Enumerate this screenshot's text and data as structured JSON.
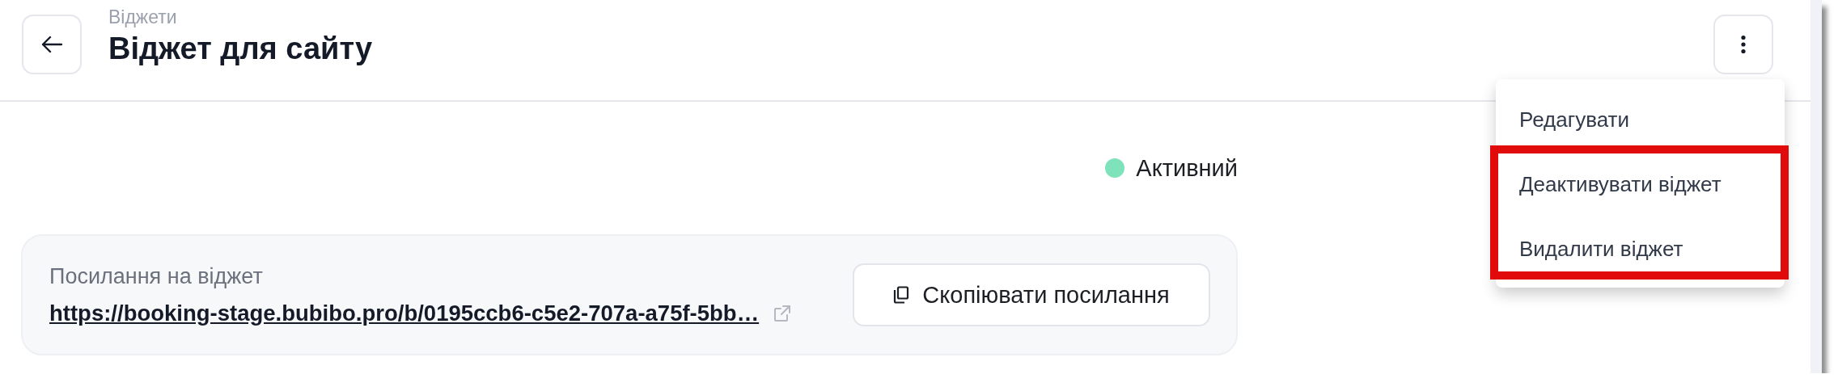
{
  "header": {
    "breadcrumb": "Віджети",
    "title": "Віджет для сайту"
  },
  "status": {
    "label": "Активний",
    "color": "#7ee2bb"
  },
  "link_card": {
    "label": "Посилання на віджет",
    "url": "https://booking-stage.bubibo.pro/b/0195ccb6-c5e2-707a-a75f-5bb…",
    "copy_button": "Скопіювати посилання"
  },
  "menu": {
    "open": true,
    "items": [
      {
        "label": "Редагувати",
        "highlighted": false
      },
      {
        "label": "Деактивувати віджет",
        "highlighted": true
      },
      {
        "label": "Видалити віджет",
        "highlighted": true
      }
    ]
  }
}
